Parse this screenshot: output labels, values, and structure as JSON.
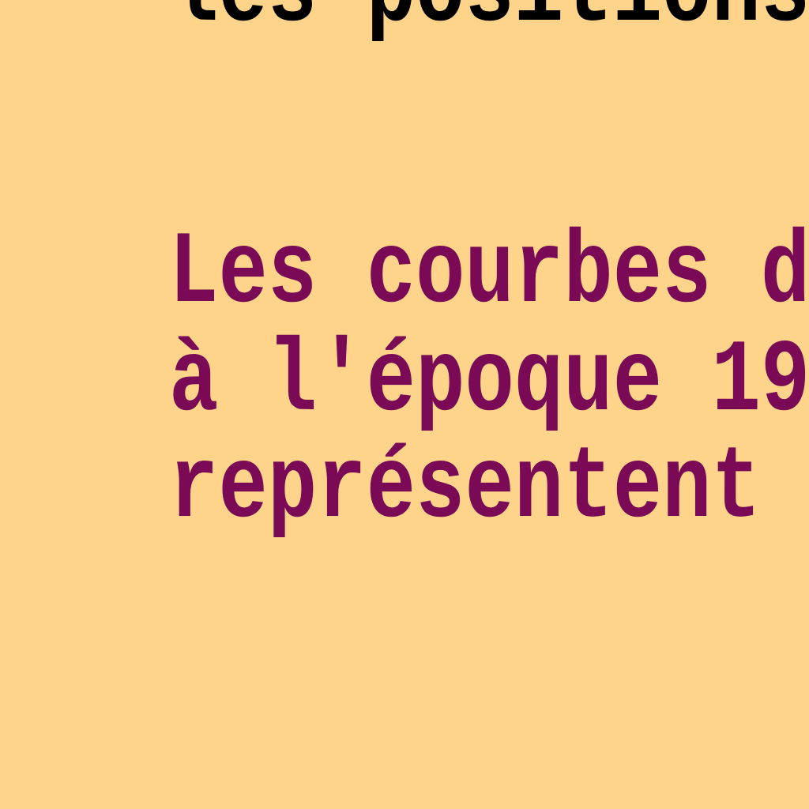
{
  "heading_fragment": "les positions",
  "paragraph": {
    "lines": [
      "Les courbes d",
      "à l'époque 19",
      "représentent"
    ]
  },
  "colors": {
    "background": "#FED48B",
    "paragraph_text": "#7A0A56",
    "heading_text": "#000000"
  }
}
